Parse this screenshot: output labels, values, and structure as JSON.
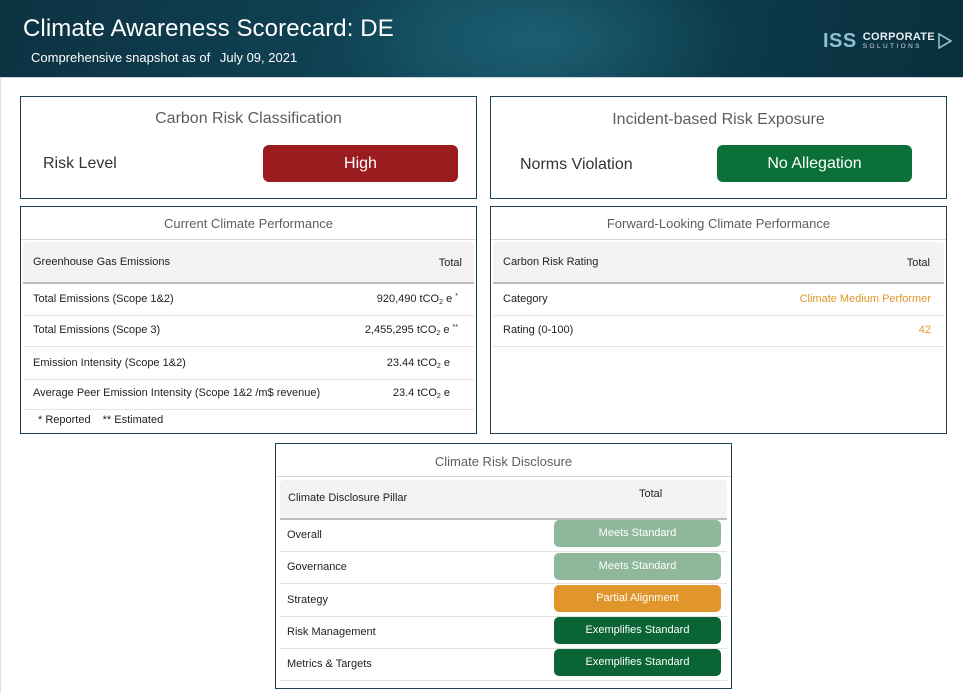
{
  "header": {
    "title": "Climate Awareness Scorecard: DE",
    "subtitle_prefix": "Comprehensive snapshot as of",
    "date": "July 09, 2021",
    "logo_iss": "ISS",
    "logo_corporate": "CORPORATE",
    "logo_solutions": "SOLUTIONS"
  },
  "carbon_risk": {
    "title": "Carbon Risk Classification",
    "label": "Risk Level",
    "value": "High",
    "value_color": "#9b1c1f"
  },
  "incident_risk": {
    "title": "Incident-based Risk Exposure",
    "label": "Norms Violation",
    "value": "No Allegation",
    "value_color": "#0a7038"
  },
  "current_performance": {
    "title": "Current Climate Performance",
    "header_left": "Greenhouse Gas Emissions",
    "header_right": "Total",
    "rows": [
      {
        "label": "Total Emissions (Scope 1&2)",
        "value": "920,490 tCO",
        "sub": "2",
        "unit": "e",
        "mark": "*"
      },
      {
        "label": "Total Emissions (Scope 3)",
        "value": "2,455,295 tCO",
        "sub": "2",
        "unit": "e",
        "mark": "**"
      },
      {
        "label": "Emission Intensity (Scope 1&2)",
        "value": "23.44 tCO",
        "sub": "2",
        "unit": "e",
        "mark": ""
      },
      {
        "label": "Average Peer Emission Intensity (Scope 1&2 /m$ revenue)",
        "value": "23.4 tCO",
        "sub": "2",
        "unit": "e",
        "mark": ""
      }
    ],
    "footnote_reported": "* Reported",
    "footnote_estimated": "** Estimated"
  },
  "forward_performance": {
    "title": "Forward-Looking Climate Performance",
    "header_left": "Carbon Risk Rating",
    "header_right": "Total",
    "rows": [
      {
        "label": "Category",
        "value": "Climate Medium Performer"
      },
      {
        "label": "Rating (0-100)",
        "value": "42"
      }
    ],
    "value_color": "#e0962a"
  },
  "disclosure": {
    "title": "Climate Risk Disclosure",
    "header_left": "Climate Disclosure Pillar",
    "header_right": "Total",
    "rows": [
      {
        "label": "Overall",
        "value": "Meets Standard",
        "color": "#8fb89a"
      },
      {
        "label": "Governance",
        "value": "Meets Standard",
        "color": "#8fb89a"
      },
      {
        "label": "Strategy",
        "value": "Partial Alignment",
        "color": "#e0962a"
      },
      {
        "label": "Risk Management",
        "value": "Exemplifies Standard",
        "color": "#0a6434"
      },
      {
        "label": "Metrics & Targets",
        "value": "Exemplifies Standard",
        "color": "#0a6434"
      }
    ]
  }
}
